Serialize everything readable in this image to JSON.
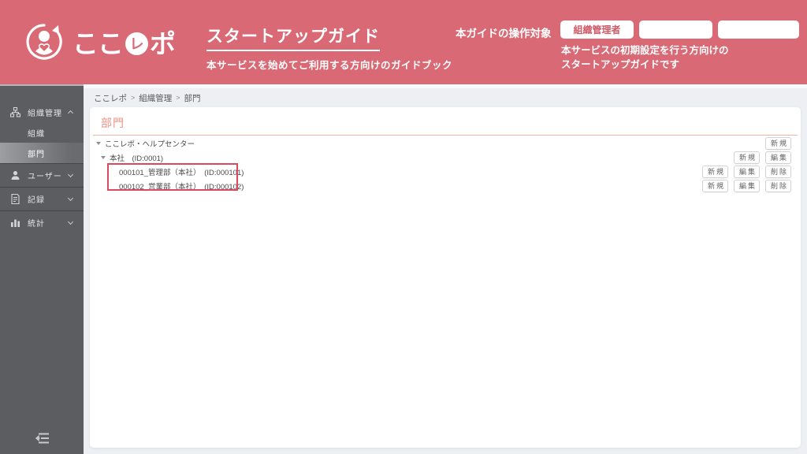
{
  "header": {
    "brand": {
      "text_main": "ここ",
      "text_circle": "レ",
      "text_suffix": "ポ"
    },
    "title": "スタートアップガイド",
    "subtitle": "本サービスを始めてご利用する方向けのガイドブック",
    "audience_label": "本ガイドの操作対象",
    "audience_tags": [
      {
        "label": "組織管理者"
      },
      {
        "label": ""
      },
      {
        "label": ""
      }
    ],
    "description_line1": "本サービスの初期設定を行う方向けの",
    "description_line2": "スタートアップガイドです"
  },
  "sidebar": {
    "items": [
      {
        "label": "組織管理",
        "icon": "sitemap-icon",
        "expanded": true
      },
      {
        "label": "組織"
      },
      {
        "label": "部門",
        "selected": true
      },
      {
        "label": "ユーザー",
        "icon": "user-icon",
        "expanded": false
      },
      {
        "label": "記録",
        "icon": "record-icon",
        "expanded": false
      },
      {
        "label": "統計",
        "icon": "stats-icon",
        "expanded": false
      }
    ]
  },
  "breadcrumb": {
    "sep": ">",
    "items": [
      {
        "label": "ここレポ"
      },
      {
        "label": "組織管理"
      },
      {
        "label": "部門"
      }
    ]
  },
  "main": {
    "page_title": "部門",
    "tree": [
      {
        "label": "ここレポ・ヘルプセンター",
        "level": 0,
        "buttons": {
          "new": "新規"
        }
      },
      {
        "label": "本社　(ID:0001)",
        "level": 1,
        "buttons": {
          "new": "新規",
          "edit": "編集"
        }
      },
      {
        "label": "000101_管理部（本社）　(ID:000101)",
        "level": 2,
        "highlighted": true,
        "buttons": {
          "new": "新規",
          "edit": "編集",
          "delete": "削除"
        }
      },
      {
        "label": "000102_営業部（本社）　(ID:000102)",
        "level": 2,
        "highlighted": true,
        "buttons": {
          "new": "新規",
          "edit": "編集",
          "delete": "削除"
        }
      }
    ]
  },
  "colors": {
    "header_bg": "#d96a75",
    "sidebar_bg": "#5c5d61",
    "title_accent": "#ee9184",
    "highlight_border": "#d84b5f"
  }
}
